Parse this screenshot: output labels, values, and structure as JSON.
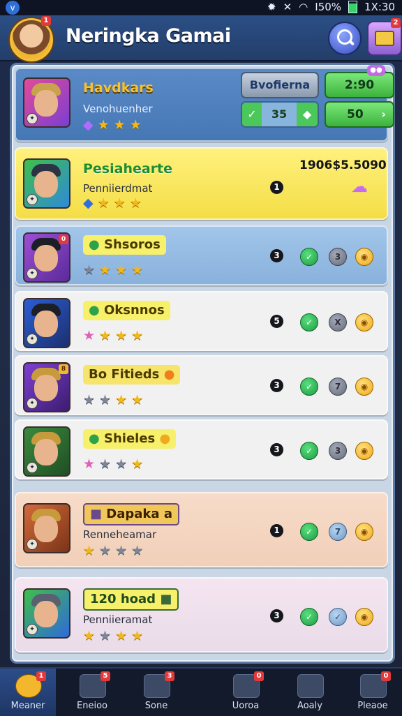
{
  "status_bar": {
    "left_icon": "app-notification-icon",
    "battery_text": "I50%",
    "time": "1X:30"
  },
  "header": {
    "title": "Neringka Gamai",
    "avatar_badge": "1",
    "search_icon": "search-icon",
    "box_icon": "chest-icon",
    "box_badge": "2"
  },
  "top_player": {
    "name": "Havdkars",
    "sub": "Venohuenher",
    "stars": [
      "gem",
      "on",
      "on",
      "on"
    ],
    "pill_gray": "Bvofierna",
    "pill_green_top": "2:90",
    "seg_value": "35",
    "pill_green_bottom": "50",
    "corner_badge": "●●"
  },
  "rows": [
    {
      "name": "Pesiahearte",
      "sub": "Penniierdmat",
      "stars": [
        "gem-blue",
        "on",
        "on",
        "on"
      ],
      "rank": "1",
      "score": "1906$5.5090",
      "theme": "yellow"
    },
    {
      "name": "Shsoros",
      "stars": [
        "off",
        "on",
        "on",
        "on"
      ],
      "rank": "3",
      "icons": [
        "",
        "3",
        ""
      ],
      "theme": "blue"
    },
    {
      "name": "Oksnnos",
      "stars": [
        "pink",
        "on",
        "on",
        "on"
      ],
      "rank": "5",
      "icons": [
        "",
        "X",
        ""
      ],
      "theme": "white"
    },
    {
      "name": "Bo Fitieds",
      "stars": [
        "off",
        "off",
        "on",
        "on"
      ],
      "rank": "3",
      "icons": [
        "",
        "7",
        ""
      ],
      "theme": "white"
    },
    {
      "name": "Shieles",
      "stars": [
        "pink",
        "off",
        "off",
        "on"
      ],
      "rank": "3",
      "icons": [
        "",
        "3",
        ""
      ],
      "theme": "white"
    },
    {
      "name": "Dapaka",
      "tag_suffix": "a",
      "sub": "Renneheamar",
      "stars": [
        "on",
        "off",
        "off",
        "off"
      ],
      "rank": "1",
      "icons": [
        "",
        "7",
        ""
      ],
      "theme": "peach"
    },
    {
      "name": "120 hoad",
      "sub": "Penniieramat",
      "stars": [
        "on",
        "off",
        "on",
        "on"
      ],
      "rank": "3",
      "icons": [
        "",
        "",
        ""
      ],
      "theme": "lilac"
    }
  ],
  "footer_tabs": [
    {
      "label": "Meaner",
      "icon": "chat-icon",
      "badge": "1"
    },
    {
      "label": "Eneioo",
      "icon": "shop-icon",
      "badge": "5"
    },
    {
      "label": "Sone",
      "icon": "inbox-icon",
      "badge": "3"
    },
    {
      "label": "Uoroa",
      "icon": "folder-icon",
      "badge": "0"
    },
    {
      "label": "Aoaly",
      "icon": "profile-icon",
      "badge": ""
    },
    {
      "label": "Pleaoe",
      "icon": "settings-icon",
      "badge": "0"
    }
  ]
}
